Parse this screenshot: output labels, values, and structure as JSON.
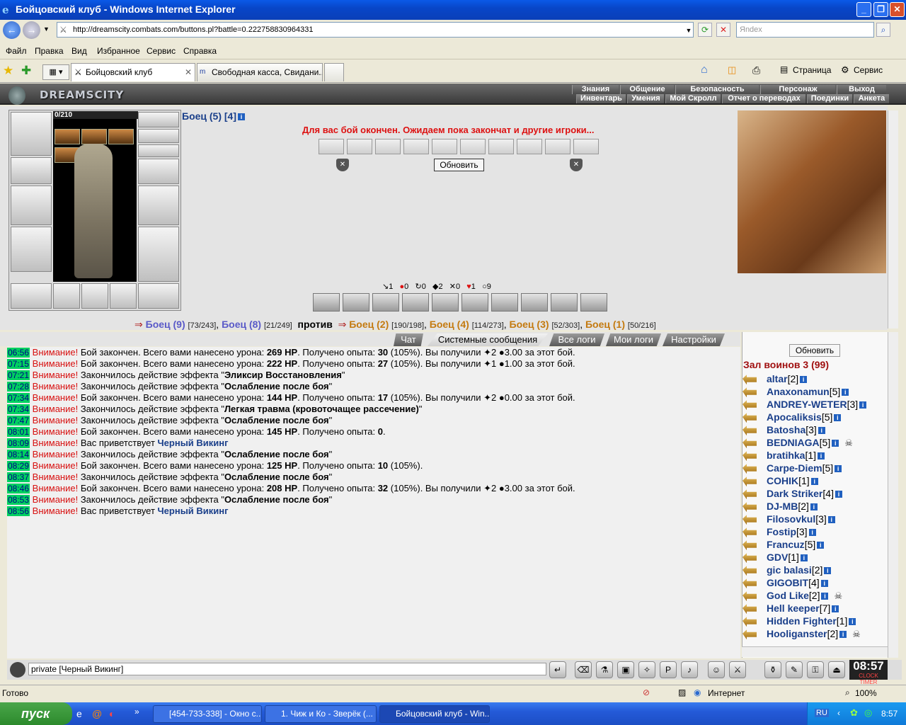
{
  "window": {
    "title": "Бойцовский клуб - Windows Internet Explorer"
  },
  "address": {
    "url": "http://dreamscity.combats.com/buttons.pl?battle=0.222758830964331",
    "search_placeholder": "Яndex"
  },
  "menu": [
    "Файл",
    "Правка",
    "Вид",
    "Избранное",
    "Сервис",
    "Справка"
  ],
  "tabs": [
    {
      "label": "Бойцовский клуб"
    },
    {
      "label": "Свободная касса, Свидани..."
    }
  ],
  "toolbar": {
    "page_label": "Страница",
    "service_label": "Сервис"
  },
  "game": {
    "logo": "DREAMSCITY",
    "nav_top": [
      "Знания",
      "Общение",
      "Безопасность",
      "Персонаж",
      "Выход"
    ],
    "nav_bottom": [
      "Инвентарь",
      "Умения",
      "Мой Скролл",
      "Отчет о переводах",
      "Поединки",
      "Анкета"
    ],
    "hp": "0/210",
    "fighter_name": "Боец (5) [4]",
    "battle_message": "Для вас бой окончен. Ожидаем пока закончат и другие игроки...",
    "refresh_label": "Обновить",
    "stats": [
      {
        "icon": "sword-icon",
        "value": "1"
      },
      {
        "icon": "blood-drop-icon",
        "value": "0"
      },
      {
        "icon": "counter-icon",
        "value": "0"
      },
      {
        "icon": "block-icon",
        "value": "2"
      },
      {
        "icon": "cross-icon",
        "value": "0"
      },
      {
        "icon": "heart-icon",
        "value": "1"
      },
      {
        "icon": "shield-icon",
        "value": "9"
      }
    ],
    "team1": [
      {
        "name": "Боец (9)",
        "hp": "[73/243]"
      },
      {
        "name": "Боец (8)",
        "hp": "[21/249]"
      }
    ],
    "vs_label": "против",
    "team2": [
      {
        "name": "Боец (2)",
        "hp": "[190/198]"
      },
      {
        "name": "Боец (4)",
        "hp": "[114/273]"
      },
      {
        "name": "Боец (3)",
        "hp": "[52/303]"
      },
      {
        "name": "Боец (1)",
        "hp": "[50/216]"
      }
    ],
    "log_tabs": [
      "Чат",
      "Системные сообщения",
      "Все логи",
      "Мои логи",
      "Настройки"
    ],
    "log": [
      {
        "t": "06:56",
        "w": "Внимание!",
        "a": " Бой закончен. Всего вами нанесено урона: ",
        "b": "269 HP",
        "c": ". Получено опыта: ",
        "d": "30",
        "e": " (105%). Вы получили ",
        "f": "✦2 ●3.00 за этот бой."
      },
      {
        "t": "07:15",
        "w": "Внимание!",
        "a": " Бой закончен. Всего вами нанесено урона: ",
        "b": "222 HP",
        "c": ". Получено опыта: ",
        "d": "27",
        "e": " (105%). Вы получили ",
        "f": "✦1 ●1.00 за этот бой."
      },
      {
        "t": "07:21",
        "w": "Внимание!",
        "a": " Закончилось действие эффекта \"",
        "b": "Эликсир Восстановления",
        "c": "\"",
        "d": "",
        "e": "",
        "f": ""
      },
      {
        "t": "07:28",
        "w": "Внимание!",
        "a": " Закончилось действие эффекта \"",
        "b": "Ослабление после боя",
        "c": "\"",
        "d": "",
        "e": "",
        "f": ""
      },
      {
        "t": "07:34",
        "w": "Внимание!",
        "a": " Бой закончен. Всего вами нанесено урона: ",
        "b": "144 HP",
        "c": ". Получено опыта: ",
        "d": "17",
        "e": " (105%). Вы получили ",
        "f": "✦2 ●0.00 за этот бой."
      },
      {
        "t": "07:34",
        "w": "Внимание!",
        "a": " Закончилось действие эффекта \"",
        "b": "Легкая травма (кровоточащее рассечение)",
        "c": "\"",
        "d": "",
        "e": "",
        "f": ""
      },
      {
        "t": "07:47",
        "w": "Внимание!",
        "a": " Закончилось действие эффекта \"",
        "b": "Ослабление после боя",
        "c": "\"",
        "d": "",
        "e": "",
        "f": ""
      },
      {
        "t": "08:01",
        "w": "Внимание!",
        "a": " Бой закончен. Всего вами нанесено урона: ",
        "b": "145 HP",
        "c": ". Получено опыта: ",
        "d": "0",
        "e": ".",
        "f": ""
      },
      {
        "t": "08:09",
        "w": "Внимание!",
        "a": " Вас приветствует ",
        "b": "",
        "c": "",
        "d": "",
        "e": "",
        "f": "",
        "link": "Черный Викинг"
      },
      {
        "t": "08:14",
        "w": "Внимание!",
        "a": " Закончилось действие эффекта \"",
        "b": "Ослабление после боя",
        "c": "\"",
        "d": "",
        "e": "",
        "f": ""
      },
      {
        "t": "08:29",
        "w": "Внимание!",
        "a": " Бой закончен. Всего вами нанесено урона: ",
        "b": "125 HP",
        "c": ". Получено опыта: ",
        "d": "10",
        "e": " (105%).",
        "f": ""
      },
      {
        "t": "08:37",
        "w": "Внимание!",
        "a": " Закончилось действие эффекта \"",
        "b": "Ослабление после боя",
        "c": "\"",
        "d": "",
        "e": "",
        "f": ""
      },
      {
        "t": "08:46",
        "w": "Внимание!",
        "a": " Бой закончен. Всего вами нанесено урона: ",
        "b": "208 HP",
        "c": ". Получено опыта: ",
        "d": "32",
        "e": " (105%). Вы получили ",
        "f": "✦2 ●3.00 за этот бой."
      },
      {
        "t": "08:53",
        "w": "Внимание!",
        "a": " Закончилось действие эффекта \"",
        "b": "Ослабление после боя",
        "c": "\"",
        "d": "",
        "e": "",
        "f": ""
      },
      {
        "t": "08:56",
        "w": "Внимание!",
        "a": " Вас приветствует ",
        "b": "",
        "c": "",
        "d": "",
        "e": "",
        "f": "",
        "link": "Черный Викинг"
      }
    ],
    "hall_title": "Зал воинов 3 (99)",
    "players": [
      {
        "name": "altar",
        "lvl": "[2]"
      },
      {
        "name": "Anaxonamun",
        "lvl": "[5]"
      },
      {
        "name": "ANDREY-WETER",
        "lvl": "[3]"
      },
      {
        "name": "Apocaliksis",
        "lvl": "[5]"
      },
      {
        "name": "Batosha",
        "lvl": "[3]"
      },
      {
        "name": "BEDNIAGA",
        "lvl": "[5]",
        "skull": true
      },
      {
        "name": "bratihka",
        "lvl": "[1]"
      },
      {
        "name": "Carpe-Diem",
        "lvl": "[5]"
      },
      {
        "name": "COHIK",
        "lvl": "[1]"
      },
      {
        "name": "Dark Striker",
        "lvl": "[4]"
      },
      {
        "name": "DJ-MB",
        "lvl": "[2]"
      },
      {
        "name": "Filosovkul",
        "lvl": "[3]"
      },
      {
        "name": "Fostip",
        "lvl": "[3]"
      },
      {
        "name": "Francuz",
        "lvl": "[5]"
      },
      {
        "name": "GDV",
        "lvl": "[1]"
      },
      {
        "name": "gic balasi",
        "lvl": "[2]"
      },
      {
        "name": "GIGOBIT",
        "lvl": "[4]"
      },
      {
        "name": "God Like",
        "lvl": "[2]",
        "skull": true
      },
      {
        "name": "Hell keeper",
        "lvl": "[7]"
      },
      {
        "name": "Hidden Fighter",
        "lvl": "[1]"
      },
      {
        "name": "Hooliganster",
        "lvl": "[2]",
        "skull": true
      }
    ],
    "chat_input": "private [Черный Викинг]",
    "clock": "08:57",
    "clock_label": "CLOCK   TIMER"
  },
  "status": {
    "left": "Готово",
    "zone": "Интернет",
    "zoom": "100%"
  },
  "taskbar": {
    "start": "пуск",
    "tasks": [
      "[454-733-338] - Окно с...",
      "1. Чиж и Ко - Зверёк (...",
      "Бойцовский клуб - Win..."
    ],
    "lang": "RU",
    "time": "8:57"
  }
}
